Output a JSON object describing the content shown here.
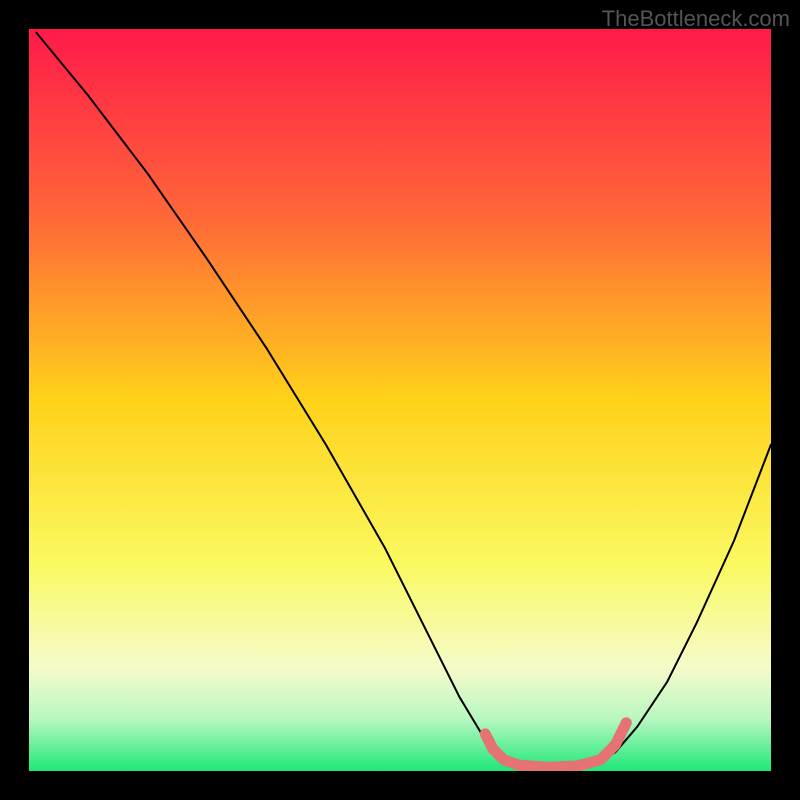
{
  "watermark": "TheBottleneck.com",
  "chart_data": {
    "type": "line",
    "title": "",
    "xlabel": "",
    "ylabel": "",
    "xlim": [
      0,
      100
    ],
    "ylim": [
      0,
      100
    ],
    "gradient_stops": [
      {
        "offset": 0,
        "color": "#ff1a4a"
      },
      {
        "offset": 25,
        "color": "#ff6638"
      },
      {
        "offset": 50,
        "color": "#ffd21a"
      },
      {
        "offset": 72,
        "color": "#faf960"
      },
      {
        "offset": 86,
        "color": "#f6fbc9"
      },
      {
        "offset": 93,
        "color": "#b8f7c1"
      },
      {
        "offset": 100,
        "color": "#1de876"
      }
    ],
    "series": [
      {
        "name": "bottleneck-curve",
        "color": "#000000",
        "points": [
          {
            "x": 1.0,
            "y": 99.5
          },
          {
            "x": 8.0,
            "y": 91.0
          },
          {
            "x": 16.0,
            "y": 80.5
          },
          {
            "x": 24.0,
            "y": 69.0
          },
          {
            "x": 32.0,
            "y": 57.0
          },
          {
            "x": 40.0,
            "y": 44.0
          },
          {
            "x": 48.0,
            "y": 30.0
          },
          {
            "x": 54.0,
            "y": 18.0
          },
          {
            "x": 58.0,
            "y": 10.0
          },
          {
            "x": 61.0,
            "y": 5.0
          },
          {
            "x": 63.0,
            "y": 2.5
          },
          {
            "x": 65.0,
            "y": 1.0
          },
          {
            "x": 68.0,
            "y": 0.5
          },
          {
            "x": 72.0,
            "y": 0.5
          },
          {
            "x": 76.0,
            "y": 1.0
          },
          {
            "x": 79.0,
            "y": 2.5
          },
          {
            "x": 82.0,
            "y": 6.0
          },
          {
            "x": 86.0,
            "y": 12.0
          },
          {
            "x": 90.0,
            "y": 20.0
          },
          {
            "x": 95.0,
            "y": 31.0
          },
          {
            "x": 100.0,
            "y": 44.0
          }
        ]
      },
      {
        "name": "optimal-zone",
        "color": "#e57373",
        "stroke_width": 11,
        "points": [
          {
            "x": 61.5,
            "y": 5.0
          },
          {
            "x": 62.5,
            "y": 3.0
          },
          {
            "x": 64.0,
            "y": 1.5
          },
          {
            "x": 66.0,
            "y": 0.8
          },
          {
            "x": 70.0,
            "y": 0.5
          },
          {
            "x": 74.0,
            "y": 0.7
          },
          {
            "x": 77.0,
            "y": 1.5
          },
          {
            "x": 79.0,
            "y": 3.5
          },
          {
            "x": 80.5,
            "y": 6.5
          }
        ]
      }
    ]
  }
}
